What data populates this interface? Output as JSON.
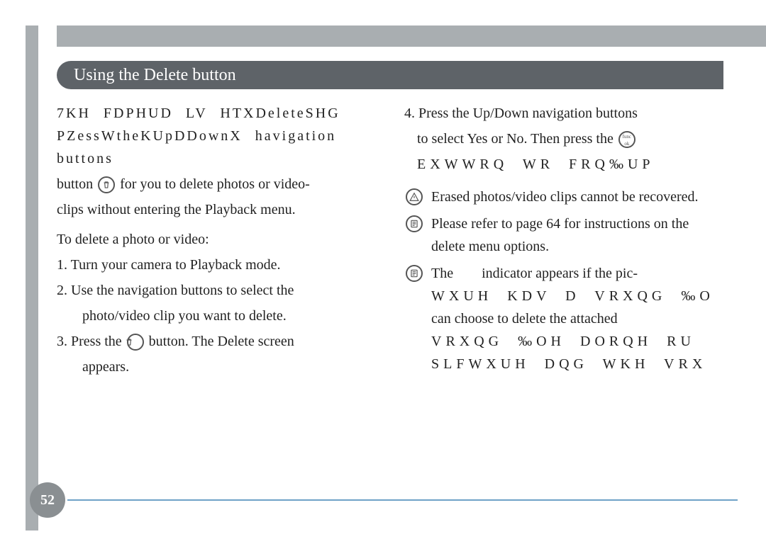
{
  "header": {
    "title": "Using the Delete button"
  },
  "left_col": {
    "intro_garbled": "7KH FDPHUD LV HTXDeleteSHG PZessWtheKUpDDownX havigation buttons",
    "intro_line2_a": "button",
    "intro_line2_b": "for you to delete photos or video-",
    "intro_line3": "clips without entering the Playback menu.",
    "subhead": "To delete a photo or video:",
    "step1": "1. Turn your camera to Playback mode.",
    "step2a": "2. Use the navigation buttons to select the",
    "step2b": "photo/video clip you want to delete.",
    "step3a": "3. Press the",
    "step3b": "button. The Delete screen",
    "step3c": "appears."
  },
  "right_col": {
    "step4a": "4. Press the Up/Down navigation buttons",
    "step4b": "to select Yes or No. Then press the",
    "garbled1": "EXWWRQ WR FRQ‰UP",
    "warn": "Erased photos/video clips cannot be recovered.",
    "note1": "Please refer to page 64 for instructions on the delete menu options.",
    "note2a": "The",
    "note2b": "indicator appears if the pic-",
    "garbled2": "WXUH KDV D VRXQG ‰O",
    "note2c": "can choose to delete the attached",
    "garbled3": "VRXQG ‰OH DORQH RU",
    "garbled4": "SLFWXUH DQG WKH VRX"
  },
  "page_number": "52",
  "icons": {
    "trash": "trash-icon",
    "func": "func-ok-icon",
    "warn": "warning-icon",
    "note": "note-icon"
  }
}
